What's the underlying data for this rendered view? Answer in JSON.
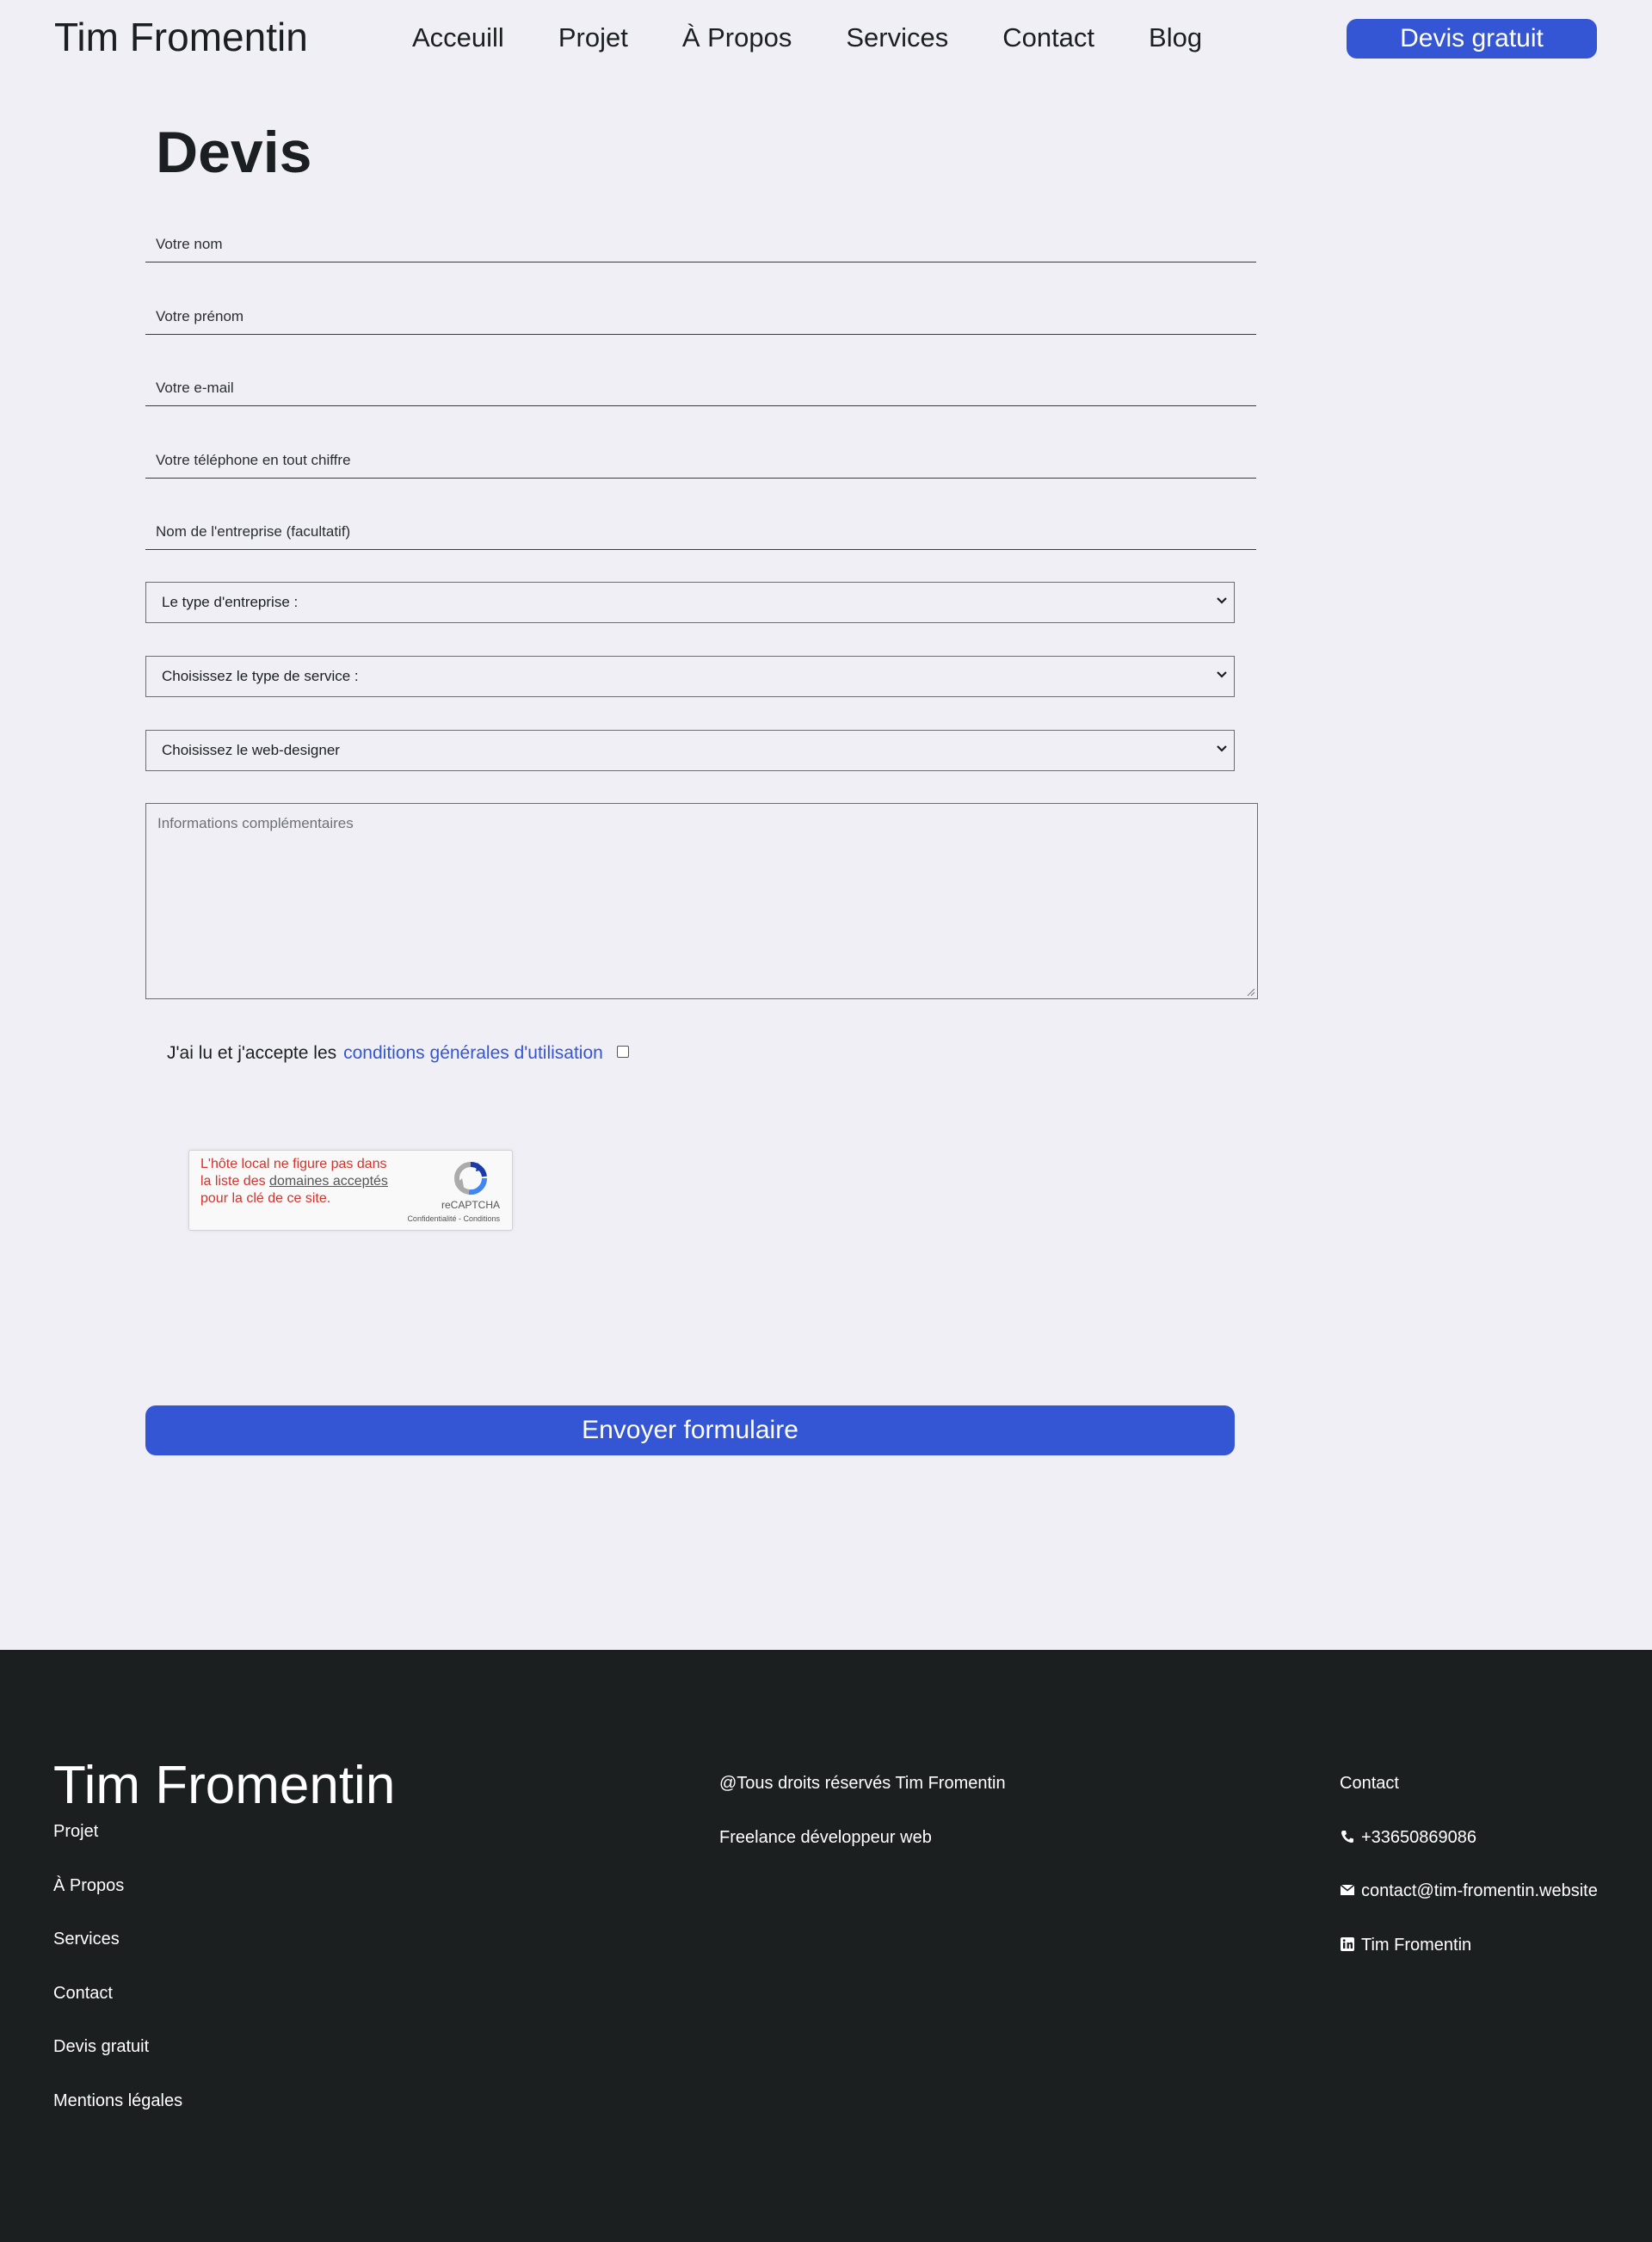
{
  "header": {
    "brand": "Tim Fromentin",
    "nav": [
      "Acceuill",
      "Projet",
      "À Propos",
      "Services",
      "Contact",
      "Blog"
    ],
    "cta_label": "Devis gratuit"
  },
  "form": {
    "title": "Devis",
    "fields": {
      "nom": "Votre nom",
      "prenom": "Votre prénom",
      "email": "Votre e-mail",
      "telephone": "Votre téléphone en tout chiffre",
      "entreprise": "Nom de l'entreprise (facultatif)"
    },
    "selects": {
      "type_entreprise": "Le type d'entreprise :",
      "type_service": "Choisissez le type de service :",
      "web_designer": "Choisissez le web-designer"
    },
    "textarea_placeholder": "Informations complémentaires",
    "terms_text": "J'ai lu et j'accepte les",
    "terms_link": "conditions générales d'utilisation",
    "recaptcha": {
      "error_part1": "L'hôte local ne figure pas dans la liste des",
      "error_link": "domaines acceptés",
      "error_part2": "pour la clé de ce site.",
      "brand": "reCAPTCHA",
      "legal": "Confidentialité - Conditions"
    },
    "submit_label": "Envoyer formulaire"
  },
  "footer": {
    "brand": "Tim Fromentin",
    "links": [
      "Projet",
      "À Propos",
      "Services",
      "Contact",
      "Devis gratuit",
      "Mentions légales"
    ],
    "copyright": "@Tous droits réservés Tim Fromentin",
    "tagline": "Freelance développeur web",
    "contact_title": "Contact",
    "phone": "+33650869086",
    "email": "contact@tim-fromentin.website",
    "linkedin": "Tim Fromentin"
  },
  "colors": {
    "background": "#efeff5",
    "accent": "#3456d4",
    "footer_bg": "#1b1f20",
    "error": "#d0342c"
  }
}
